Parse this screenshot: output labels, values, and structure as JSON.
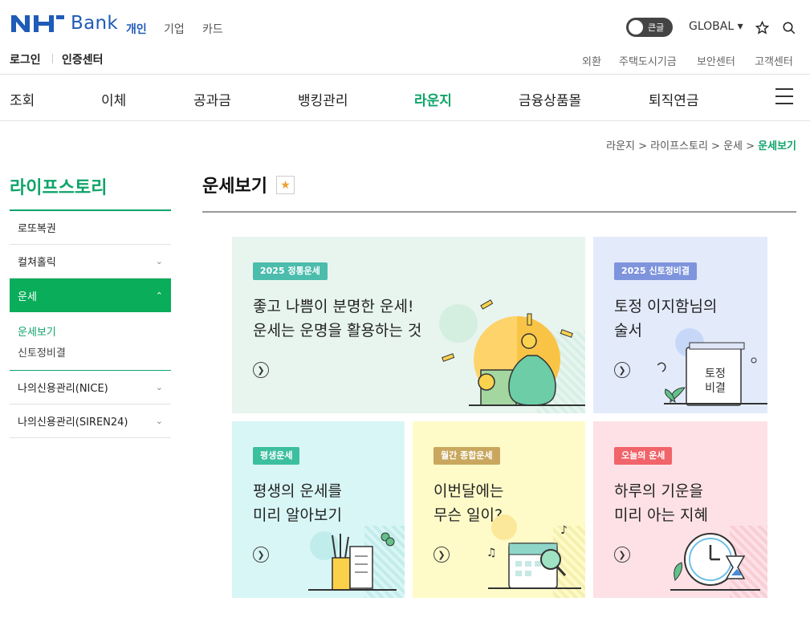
{
  "header": {
    "logo_text": "Bank",
    "segments": [
      "개인",
      "기업",
      "카드"
    ],
    "toggle_label": "큰글",
    "global_label": "GLOBAL ▾",
    "util_left": [
      "로그인",
      "인증센터"
    ],
    "util_right": [
      "외환",
      "주택도시기금",
      "보안센터",
      "고객센터"
    ]
  },
  "gnb": [
    "조회",
    "이체",
    "공과금",
    "뱅킹관리",
    "라운지",
    "금융상품몰",
    "퇴직연금"
  ],
  "breadcrumb": {
    "path": "라운지 > 라이프스토리 > 운세 > ",
    "current": "운세보기"
  },
  "sidebar": {
    "title": "라이프스토리",
    "items": [
      "로또복권",
      "컬쳐홀릭",
      "운세",
      "나의신용관리(NICE)",
      "나의신용관리(SIREN24)"
    ],
    "sub_items": [
      "운세보기",
      "신토정비결"
    ]
  },
  "page_title": "운세보기",
  "cards": [
    {
      "badge": "2025 정통운세",
      "title": "좋고 나쁨이 분명한 운세!\n운세는 운명을 활용하는 것",
      "bg": "#e8f5ef",
      "badge_color": "#4cbcad"
    },
    {
      "badge": "2025 신토정비결",
      "title": "토정 이지함님의\n술서",
      "bg": "#e3ebfb",
      "badge_color": "#7e94dc",
      "illustration_text": "토정\n비결"
    },
    {
      "badge": "평생운세",
      "title": "평생의 운세를\n미리 알아보기",
      "bg": "#d9f6f6",
      "badge_color": "#3cbf9f"
    },
    {
      "badge": "월간 종합운세",
      "title": "이번달에는\n무슨 일이?",
      "bg": "#fefbc8",
      "badge_color": "#c9a75e"
    },
    {
      "badge": "오늘의 운세",
      "title": "하루의 기운을\n미리 아는 지혜",
      "bg": "#fde1e6",
      "badge_color": "#f0646a"
    }
  ]
}
